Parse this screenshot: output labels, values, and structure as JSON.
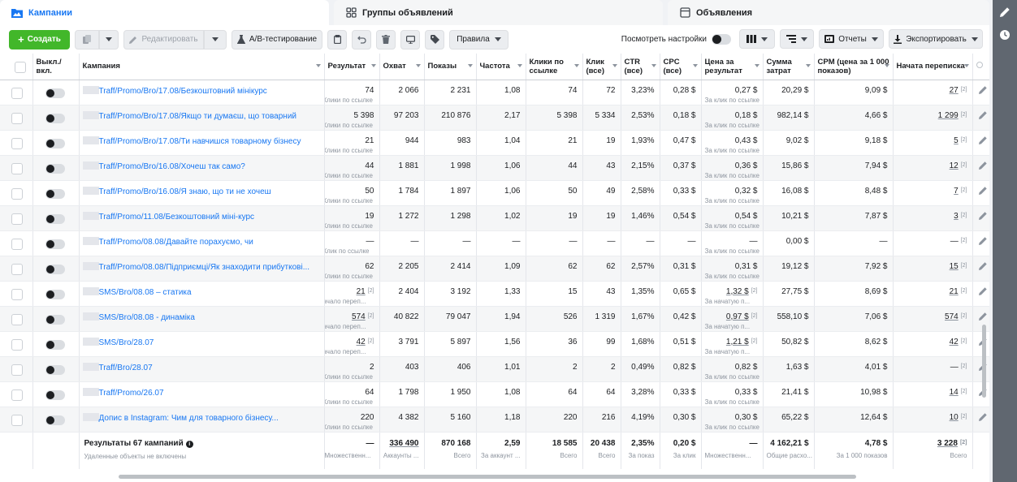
{
  "tabs": [
    {
      "label": "Кампании",
      "icon": "folder-icon"
    },
    {
      "label": "Группы объявлений",
      "icon": "grid-icon"
    },
    {
      "label": "Объявления",
      "icon": "ad-icon"
    }
  ],
  "toolbar": {
    "create": "Создать",
    "edit": "Редактировать",
    "ab_test": "A/B-тестирование",
    "rules": "Правила",
    "view_settings": "Посмотреть настройки",
    "reports": "Отчеты",
    "export": "Экспортировать"
  },
  "columns": [
    "Выкл./вкл.",
    "Кампания",
    "Результат",
    "Охват",
    "Показы",
    "Частота",
    "Клики по ссылке",
    "Клик (все)",
    "CTR (все)",
    "CPC (все)",
    "Цена за результат",
    "Сумма затрат",
    "CPM (цена за 1 000 показов)",
    "Начата переписка"
  ],
  "rows": [
    {
      "name": "Traff/Promo/Bro/17.08/Безкоштовний мінікурс",
      "result": "74",
      "result_sub": "Клики по ссылке",
      "reach": "2 066",
      "impr": "2 231",
      "freq": "1,08",
      "link_clicks": "74",
      "clicks_all": "72",
      "ctr": "3,23%",
      "cpc": "0,28 $",
      "cpr": "0,27 $",
      "cpr_sub": "За клик по ссылке",
      "spend": "20,29 $",
      "cpm": "9,09 $",
      "conv": "27"
    },
    {
      "name": "Traff/Promo/Bro/17.08/Якщо ти думаєш, що товарний",
      "result": "5 398",
      "result_sub": "Клики по ссылке",
      "reach": "97 203",
      "impr": "210 876",
      "freq": "2,17",
      "link_clicks": "5 398",
      "clicks_all": "5 334",
      "ctr": "2,53%",
      "cpc": "0,18 $",
      "cpr": "0,18 $",
      "cpr_sub": "За клик по ссылке",
      "spend": "982,14 $",
      "cpm": "4,66 $",
      "conv": "1 299"
    },
    {
      "name": "Traff/Promo/Bro/17.08/Ти навчишся товарному бізнесу",
      "result": "21",
      "result_sub": "Клики по ссылке",
      "reach": "944",
      "impr": "983",
      "freq": "1,04",
      "link_clicks": "21",
      "clicks_all": "19",
      "ctr": "1,93%",
      "cpc": "0,47 $",
      "cpr": "0,43 $",
      "cpr_sub": "За клик по ссылке",
      "spend": "9,02 $",
      "cpm": "9,18 $",
      "conv": "5"
    },
    {
      "name": "Traff/Promo/Bro/16.08/Хочеш так само?",
      "result": "44",
      "result_sub": "Клики по ссылке",
      "reach": "1 881",
      "impr": "1 998",
      "freq": "1,06",
      "link_clicks": "44",
      "clicks_all": "43",
      "ctr": "2,15%",
      "cpc": "0,37 $",
      "cpr": "0,36 $",
      "cpr_sub": "За клик по ссылке",
      "spend": "15,86 $",
      "cpm": "7,94 $",
      "conv": "12"
    },
    {
      "name": "Traff/Promo/Bro/16.08/Я знаю, що ти не хочеш",
      "result": "50",
      "result_sub": "Клики по ссылке",
      "reach": "1 784",
      "impr": "1 897",
      "freq": "1,06",
      "link_clicks": "50",
      "clicks_all": "49",
      "ctr": "2,58%",
      "cpc": "0,33 $",
      "cpr": "0,32 $",
      "cpr_sub": "За клик по ссылке",
      "spend": "16,08 $",
      "cpm": "8,48 $",
      "conv": "7"
    },
    {
      "name": "Traff/Promo/11.08/Безкоштовний міні-курс",
      "result": "19",
      "result_sub": "Клики по ссылке",
      "reach": "1 272",
      "impr": "1 298",
      "freq": "1,02",
      "link_clicks": "19",
      "clicks_all": "19",
      "ctr": "1,46%",
      "cpc": "0,54 $",
      "cpr": "0,54 $",
      "cpr_sub": "За клик по ссылке",
      "spend": "10,21 $",
      "cpm": "7,87 $",
      "conv": "3"
    },
    {
      "name": "Traff/Promo/08.08/Давайте порахуємо, чи",
      "result": "—",
      "result_sub": "Клик по ссылке",
      "reach": "—",
      "impr": "—",
      "freq": "—",
      "link_clicks": "—",
      "clicks_all": "—",
      "ctr": "—",
      "cpc": "—",
      "cpr": "—",
      "cpr_sub": "За клик по ссылке",
      "spend": "0,00 $",
      "cpm": "—",
      "conv": "—"
    },
    {
      "name": "Traff/Promo/08.08/Підприємці/Як знаходити прибуткові...",
      "result": "62",
      "result_sub": "Клики по ссылке",
      "reach": "2 205",
      "impr": "2 414",
      "freq": "1,09",
      "link_clicks": "62",
      "clicks_all": "62",
      "ctr": "2,57%",
      "cpc": "0,31 $",
      "cpr": "0,31 $",
      "cpr_sub": "За клик по ссылке",
      "spend": "19,12 $",
      "cpm": "7,92 $",
      "conv": "15"
    },
    {
      "name": "SMS/Bro/08.08 – статика",
      "result": "21",
      "result_sub": "ачало переп...",
      "reach": "2 404",
      "impr": "3 192",
      "freq": "1,33",
      "link_clicks": "15",
      "clicks_all": "43",
      "ctr": "1,35%",
      "cpc": "0,65 $",
      "cpr": "1,32 $",
      "cpr_sub": "За начатую п...",
      "spend": "27,75 $",
      "cpm": "8,69 $",
      "conv": "21"
    },
    {
      "name": "SMS/Bro/08.08 - динаміка",
      "result": "574",
      "result_sub": "ачало переп...",
      "reach": "40 822",
      "impr": "79 047",
      "freq": "1,94",
      "link_clicks": "526",
      "clicks_all": "1 319",
      "ctr": "1,67%",
      "cpc": "0,42 $",
      "cpr": "0,97 $",
      "cpr_sub": "За начатую п...",
      "spend": "558,10 $",
      "cpm": "7,06 $",
      "conv": "574"
    },
    {
      "name": "SMS/Bro/28.07",
      "result": "42",
      "result_sub": "ачало переп...",
      "reach": "3 791",
      "impr": "5 897",
      "freq": "1,56",
      "link_clicks": "36",
      "clicks_all": "99",
      "ctr": "1,68%",
      "cpc": "0,51 $",
      "cpr": "1,21 $",
      "cpr_sub": "За начатую п...",
      "spend": "50,82 $",
      "cpm": "8,62 $",
      "conv": "42"
    },
    {
      "name": "Traff/Bro/28.07",
      "result": "2",
      "result_sub": "Клики по ссылке",
      "reach": "403",
      "impr": "406",
      "freq": "1,01",
      "link_clicks": "2",
      "clicks_all": "2",
      "ctr": "0,49%",
      "cpc": "0,82 $",
      "cpr": "0,82 $",
      "cpr_sub": "За клик по ссылке",
      "spend": "1,63 $",
      "cpm": "4,01 $",
      "conv": "—"
    },
    {
      "name": "Traff/Promo/26.07",
      "result": "64",
      "result_sub": "Клики по ссылке",
      "reach": "1 798",
      "impr": "1 950",
      "freq": "1,08",
      "link_clicks": "64",
      "clicks_all": "64",
      "ctr": "3,28%",
      "cpc": "0,33 $",
      "cpr": "0,33 $",
      "cpr_sub": "За клик по ссылке",
      "spend": "21,41 $",
      "cpm": "10,98 $",
      "conv": "14"
    },
    {
      "name": "Допис в Instagram: Чим для товарного бізнесу...",
      "result": "220",
      "result_sub": "Клики по ссылке",
      "reach": "4 382",
      "impr": "5 160",
      "freq": "1,18",
      "link_clicks": "220",
      "clicks_all": "216",
      "ctr": "4,19%",
      "cpc": "0,30 $",
      "cpr": "0,30 $",
      "cpr_sub": "За клик по ссылке",
      "spend": "65,22 $",
      "cpm": "12,64 $",
      "conv": "10"
    }
  ],
  "totals": {
    "label": "Результаты 67 кампаний",
    "label_sub": "Удаленные объекты не включены",
    "result": "—",
    "result_sub": "Множественн...",
    "reach": "336 490",
    "reach_sub": "Аккаунты ...",
    "impr": "870 168",
    "impr_sub": "Всего",
    "freq": "2,59",
    "freq_sub": "За аккаунт ...",
    "link_clicks": "18 585",
    "link_clicks_sub": "Всего",
    "clicks_all": "20 438",
    "clicks_all_sub": "Всего",
    "ctr": "2,35%",
    "ctr_sub": "За показ",
    "cpc": "0,20 $",
    "cpc_sub": "За клик",
    "cpr": "—",
    "cpr_sub": "Множественн...",
    "spend": "4 162,21 $",
    "spend_sub": "Общие расхо...",
    "cpm": "4,78 $",
    "cpm_sub": "За 1 000 показов",
    "conv": "3 228",
    "conv_sub": "Всего"
  },
  "sup_mark": "[2]",
  "colors": {
    "accent": "#1877f2",
    "create": "#42b72a",
    "side_panel": "#606770"
  }
}
